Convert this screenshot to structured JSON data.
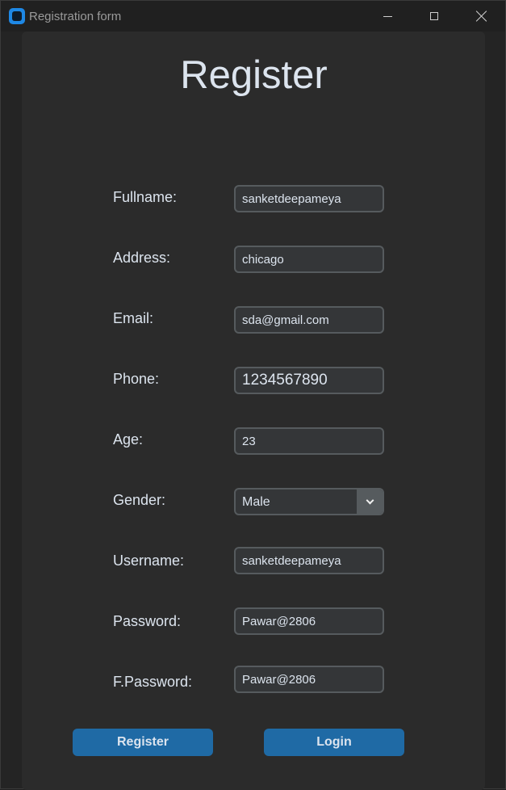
{
  "window": {
    "title": "Registration form",
    "icon": "app-icon"
  },
  "heading": "Register",
  "form": {
    "fields": [
      {
        "label": "Fullname:",
        "value": "sanketdeepameya"
      },
      {
        "label": "Address:",
        "value": "chicago"
      },
      {
        "label": "Email:",
        "value": "sda@gmail.com"
      },
      {
        "label": "Phone:",
        "value": "1234567890"
      },
      {
        "label": "Age:",
        "value": "23"
      },
      {
        "label": "Gender:",
        "value": "Male"
      },
      {
        "label": "Username:",
        "value": "sanketdeepameya"
      },
      {
        "label": "Password:",
        "value": "Pawar@2806"
      },
      {
        "label": "F.Password:",
        "value": "Pawar@2806"
      }
    ]
  },
  "buttons": {
    "register": "Register",
    "login": "Login"
  },
  "colors": {
    "accent": "#1f6aa5",
    "background": "#2b2b2b",
    "entry_bg": "#343638",
    "text": "#dce4ee"
  }
}
